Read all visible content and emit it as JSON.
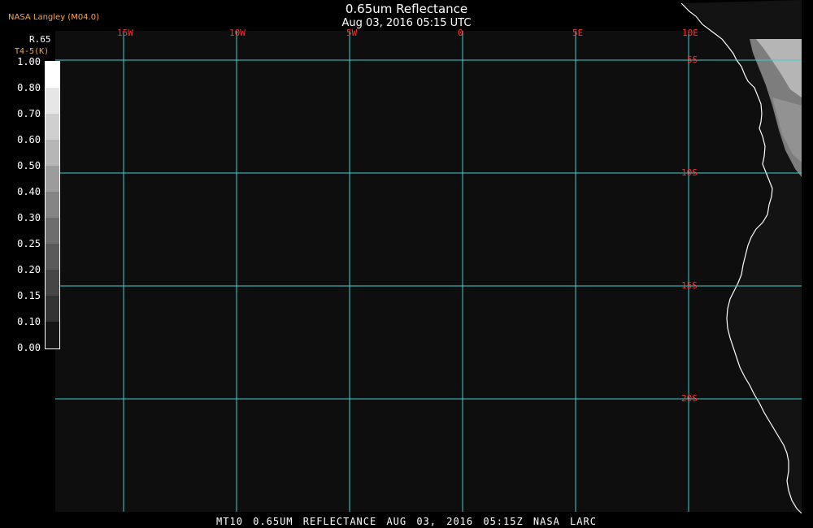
{
  "header": {
    "title": "0.65um Reflectance",
    "timestamp": "Aug 03, 2016 05:15 UTC",
    "producer": "NASA Langley (M04.0)"
  },
  "colorbar": {
    "variable": "R.65",
    "secondary_label": "T4-5(K)",
    "ticks": [
      "1.00",
      "0.80",
      "0.70",
      "0.60",
      "0.50",
      "0.40",
      "0.30",
      "0.25",
      "0.20",
      "0.15",
      "0.10",
      "0.00"
    ]
  },
  "map": {
    "lon_labels": [
      "15W",
      "10W",
      "5W",
      "0",
      "5E",
      "10E"
    ],
    "lat_labels": [
      "5S",
      "10S",
      "15S",
      "20S"
    ],
    "grid_color": "#40d0d0",
    "label_color": "#ff3030",
    "ocean_color": "#0e0e0e",
    "coastline_color": "#ffffff"
  },
  "footer": {
    "caption": "MT10  0.65UM REFLECTANCE   AUG 03, 2016 05:15Z   NASA LARC"
  }
}
